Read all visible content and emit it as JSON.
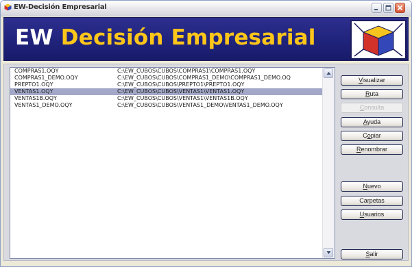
{
  "window": {
    "title": "EW-Decisión Empresarial"
  },
  "banner": {
    "title_part1": "EW",
    "title_part2": "Decisión Empresarial"
  },
  "files": [
    {
      "name": "COMPRAS1.OQY",
      "path": "C:\\EW_CUBOS\\CUBOS\\COMPRAS1\\COMPRAS1.OQY",
      "selected": false
    },
    {
      "name": "COMPRAS1_DEMO.OQY",
      "path": "C:\\EW_CUBOS\\CUBOS\\COMPRAS1_DEMO\\COMPRAS1_DEMO.OQ",
      "selected": false
    },
    {
      "name": "PREPTO1.OQY",
      "path": "C:\\EW_CUBOS\\CUBOS\\PREPTO1\\PREPTO1.OQY",
      "selected": false
    },
    {
      "name": "VENTAS1.OQY",
      "path": "C:\\EW_CUBOS\\CUBOS\\VENTAS1\\VENTAS1.OQY",
      "selected": true
    },
    {
      "name": "VENTAS1B.OQY",
      "path": "C:\\EW_CUBOS\\CUBOS\\VENTAS1\\VENTAS1B.OQY",
      "selected": false
    },
    {
      "name": "VENTAS1_DEMO.OQY",
      "path": "C:\\EW_CUBOS\\CUBOS\\VENTAS1_DEMO\\VENTAS1_DEMO.OQY",
      "selected": false
    }
  ],
  "buttons": {
    "visualizar": {
      "accel": "V",
      "rest": "isualizar"
    },
    "ruta": {
      "accel": "R",
      "rest": "uta"
    },
    "consulta": {
      "accel": "C",
      "rest": "onsulta",
      "disabled": true
    },
    "ayuda": {
      "accel": "A",
      "rest": "yuda"
    },
    "copiar": {
      "pre": "C",
      "accel": "o",
      "rest": "piar"
    },
    "renombrar": {
      "accel": "R",
      "rest": "enombrar"
    },
    "nuevo": {
      "accel": "N",
      "rest": "uevo"
    },
    "carpetas": {
      "label": "Carpetas"
    },
    "usuarios": {
      "accel": "U",
      "rest": "suarios"
    },
    "salir": {
      "accel": "S",
      "rest": "alir"
    }
  },
  "colors": {
    "banner_bg": "#1f2279",
    "title_yellow": "#ffc61a",
    "selection": "#a3a8c8"
  },
  "icons": [
    "app-cube-icon",
    "minimize-icon",
    "maximize-icon",
    "close-icon",
    "scroll-up-icon",
    "scroll-down-icon",
    "cube-logo-icon"
  ]
}
